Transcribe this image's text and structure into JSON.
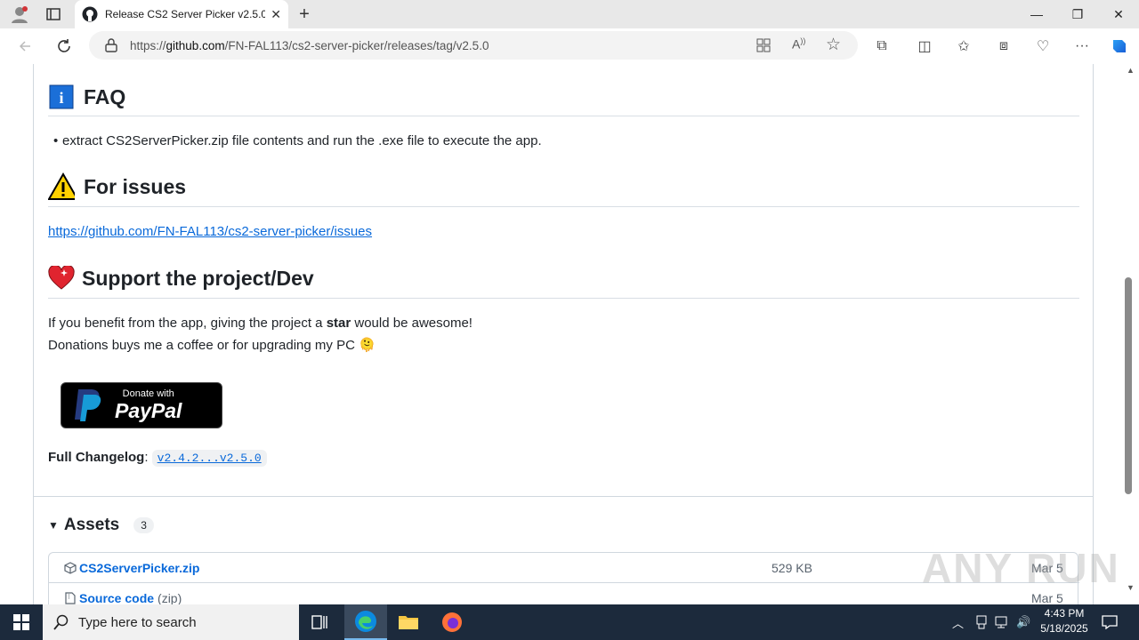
{
  "browser": {
    "tab_title": "Release CS2 Server Picker v2.5.0 ·",
    "url_prefix": "https://",
    "url_host": "github.com",
    "url_path": "/FN-FAL113/cs2-server-picker/releases/tag/v2.5.0"
  },
  "content": {
    "faq_heading": "FAQ",
    "faq_item": "extract CS2ServerPicker.zip file contents and run the .exe file to execute the app.",
    "issues_heading": "For issues",
    "issues_link": "https://github.com/FN-FAL113/cs2-server-picker/issues",
    "support_heading": "Support the project/Dev",
    "support_line1_a": "If you benefit from the app, giving the project a ",
    "support_line1_b": "star",
    "support_line1_c": " would be awesome!",
    "support_line2": "Donations buys me a coffee or for upgrading my PC 🫠",
    "paypal_small": "Donate with",
    "paypal_big": "PayPal",
    "changelog_label": "Full Changelog",
    "changelog_colon": ":",
    "changelog_link": "v2.4.2...v2.5.0"
  },
  "assets": {
    "label": "Assets",
    "count": "3",
    "rows": [
      {
        "name": "CS2ServerPicker.zip",
        "suffix": "",
        "size": "529 KB",
        "date": "Mar 5"
      },
      {
        "name": "Source code",
        "suffix": "(zip)",
        "size": "",
        "date": "Mar 5"
      }
    ]
  },
  "watermark": "ANY RUN",
  "taskbar": {
    "search_placeholder": "Type here to search",
    "time": "4:43 PM",
    "date": "5/18/2025"
  },
  "colors": {
    "link": "#0969da",
    "taskbar": "#1c2a3c",
    "accent_edge": "#0078d4"
  }
}
